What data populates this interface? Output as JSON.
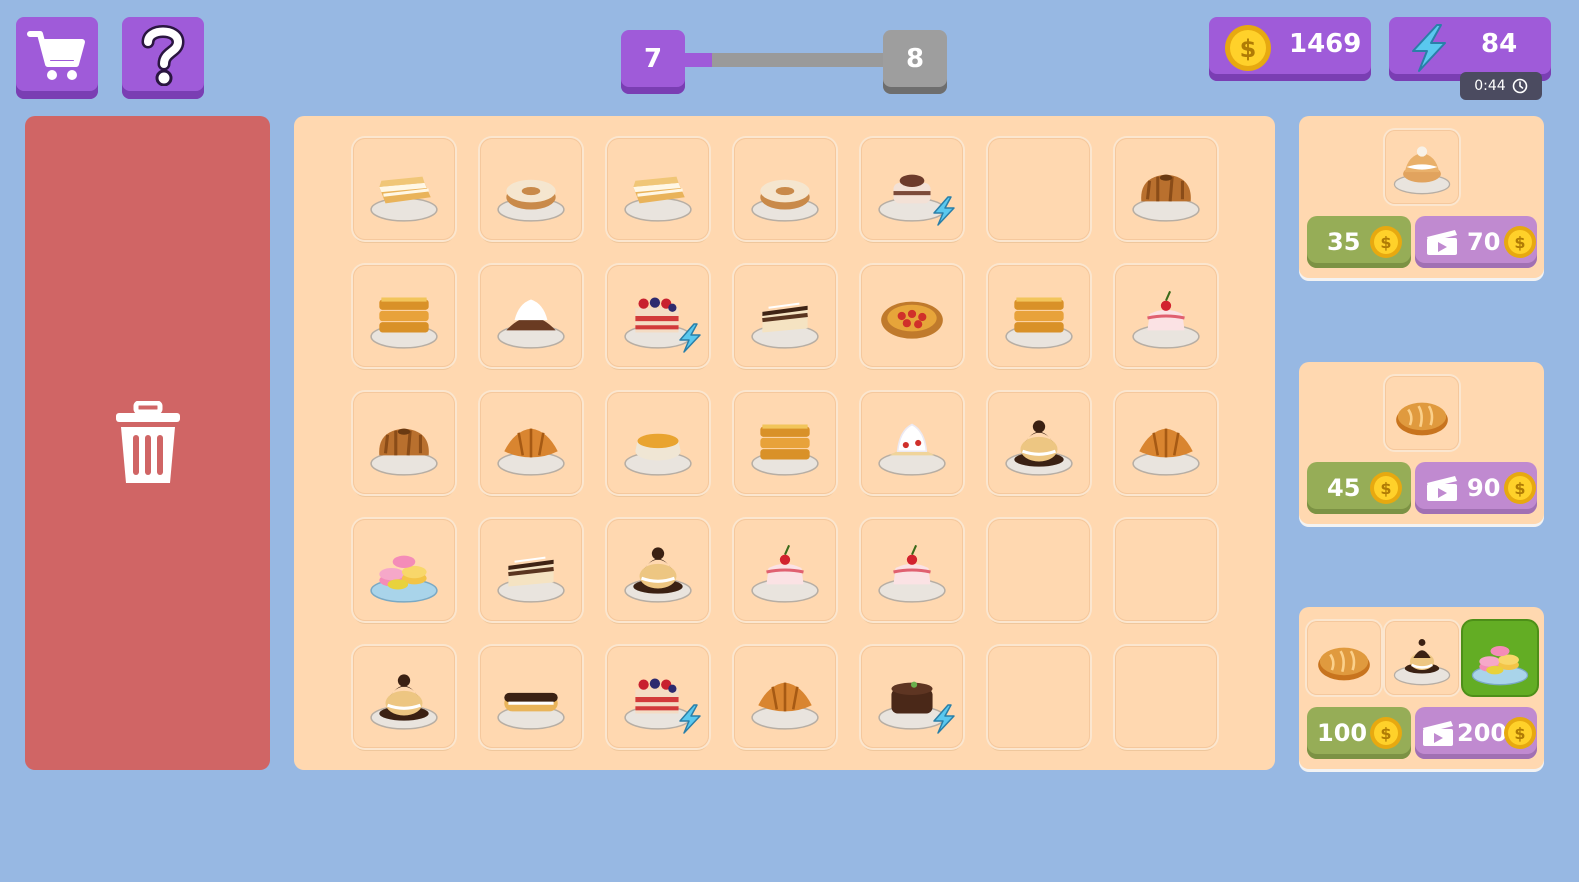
{
  "toolbar": {
    "shop_icon": "shopping-cart-icon",
    "help_icon": "question-mark-icon"
  },
  "level": {
    "current": "7",
    "next": "8",
    "progress": 0.14
  },
  "resources": {
    "coins": "1469",
    "energy": "84",
    "energy_timer": "0:44"
  },
  "colors": {
    "purple": "#9f5bd9",
    "trash": "#d06565",
    "board": "#ffd8b0",
    "green": "#96ad57",
    "violet": "#c08ad0"
  },
  "board": {
    "rows": [
      [
        {
          "item": "mille-feuille"
        },
        {
          "item": "cream-ring-cake"
        },
        {
          "item": "mille-feuille"
        },
        {
          "item": "cream-ring-cake"
        },
        {
          "item": "layered-cream-cake",
          "bolt": true
        },
        {
          "item": ""
        },
        {
          "item": "bundt-cake"
        }
      ],
      [
        {
          "item": "french-toast-stack"
        },
        {
          "item": "chocolate-cream-puff"
        },
        {
          "item": "berry-layer-cake",
          "bolt": true
        },
        {
          "item": "tiramisu-slice"
        },
        {
          "item": "cherry-tart"
        },
        {
          "item": "french-toast-stack"
        },
        {
          "item": "cherry-cream-cake"
        }
      ],
      [
        {
          "item": "bundt-cake"
        },
        {
          "item": "croissant"
        },
        {
          "item": "custard-pudding"
        },
        {
          "item": "french-toast-stack"
        },
        {
          "item": "cream-meringue"
        },
        {
          "item": "profiterole"
        },
        {
          "item": "croissant"
        }
      ],
      [
        {
          "item": "macarons"
        },
        {
          "item": "tiramisu-slice"
        },
        {
          "item": "profiterole"
        },
        {
          "item": "cherry-cream-cake"
        },
        {
          "item": "cherry-cream-cake"
        },
        {
          "item": ""
        },
        {
          "item": ""
        }
      ],
      [
        {
          "item": "profiterole"
        },
        {
          "item": "eclair"
        },
        {
          "item": "berry-layer-cake",
          "bolt": true
        },
        {
          "item": "croissant"
        },
        {
          "item": "chocolate-mousse-cake",
          "bolt": true
        },
        {
          "item": ""
        },
        {
          "item": ""
        }
      ]
    ]
  },
  "orders": [
    {
      "items": [
        "cream-bun"
      ],
      "price": "35",
      "ad_price": "70"
    },
    {
      "items": [
        "bread-loaf"
      ],
      "price": "45",
      "ad_price": "90"
    },
    {
      "items": [
        "bread-loaf",
        "cream-puff-tower",
        "macarons"
      ],
      "price": "100",
      "ad_price": "200"
    }
  ]
}
